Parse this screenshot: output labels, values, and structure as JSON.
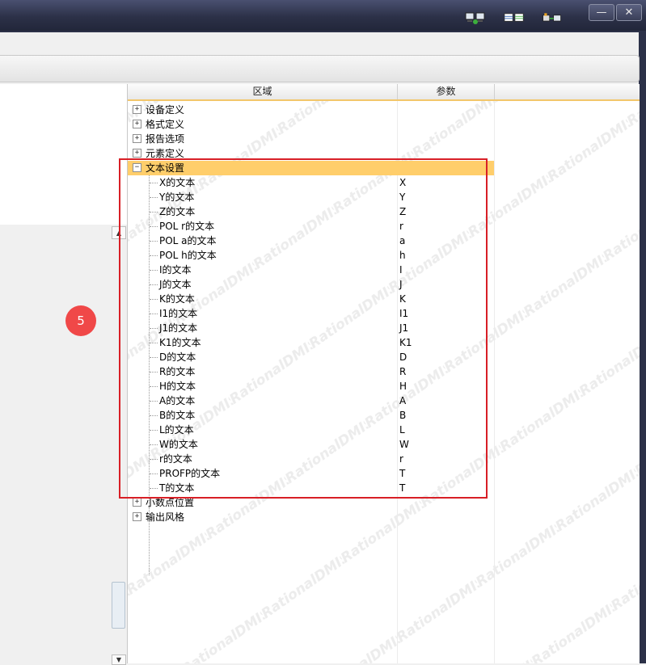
{
  "titlebar": {
    "icons": [
      "monitor-sync-icon",
      "table-export-icon",
      "device-link-icon"
    ],
    "minimize_label": "—",
    "close_label": "✕"
  },
  "badge": {
    "label": "5"
  },
  "tree": {
    "columns": [
      "区域",
      "参数"
    ],
    "top_items": [
      {
        "label": "设备定义",
        "expanded": false
      },
      {
        "label": "格式定义",
        "expanded": false
      },
      {
        "label": "报告选项",
        "expanded": false
      },
      {
        "label": "元素定义",
        "expanded": false
      }
    ],
    "text_settings": {
      "label": "文本设置",
      "expanded": true,
      "children": [
        {
          "label": "X的文本",
          "value": "X"
        },
        {
          "label": "Y的文本",
          "value": "Y"
        },
        {
          "label": "Z的文本",
          "value": "Z"
        },
        {
          "label": "POL r的文本",
          "value": "r"
        },
        {
          "label": "POL a的文本",
          "value": "a"
        },
        {
          "label": "POL h的文本",
          "value": "h"
        },
        {
          "label": "I的文本",
          "value": "I"
        },
        {
          "label": "J的文本",
          "value": "J"
        },
        {
          "label": "K的文本",
          "value": "K"
        },
        {
          "label": "I1的文本",
          "value": "I1"
        },
        {
          "label": "J1的文本",
          "value": "J1"
        },
        {
          "label": "K1的文本",
          "value": "K1"
        },
        {
          "label": "D的文本",
          "value": "D"
        },
        {
          "label": "R的文本",
          "value": "R"
        },
        {
          "label": "H的文本",
          "value": "H"
        },
        {
          "label": "A的文本",
          "value": "A"
        },
        {
          "label": "B的文本",
          "value": "B"
        },
        {
          "label": "L的文本",
          "value": "L"
        },
        {
          "label": "W的文本",
          "value": "W"
        },
        {
          "label": "r的文本",
          "value": "r"
        },
        {
          "label": "PROFP的文本",
          "value": "T"
        },
        {
          "label": "T的文本",
          "value": "T"
        }
      ]
    },
    "bottom_items": [
      {
        "label": "小数点位置",
        "expanded": false
      },
      {
        "label": "输出风格",
        "expanded": false
      }
    ],
    "watermark": "RationalDMIS"
  },
  "colors": {
    "highlight": "#ffce6b",
    "annotation_red": "#d81f26",
    "badge": "#f04848",
    "titlebar": "#2c3148"
  }
}
